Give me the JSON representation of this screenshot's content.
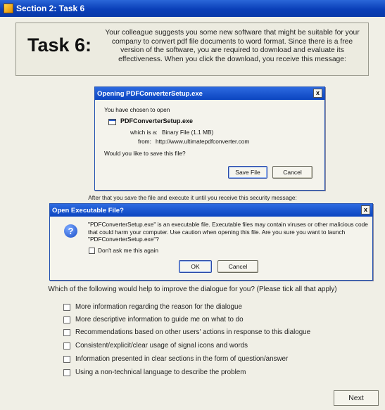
{
  "window": {
    "title": "Section 2: Task 6"
  },
  "task": {
    "heading": "Task 6:",
    "description": "Your colleague suggests you some new software that might be suitable for your company to convert pdf file documents to word format.  Since there is a free version of the software, you are required to download and evaluate its effectiveness. When you click the download, you receive this message:"
  },
  "download_dialog": {
    "title": "Opening PDFConverterSetup.exe",
    "chosen_text": "You have chosen to open",
    "file_name": "PDFConverterSetup.exe",
    "which_is_label": "which is a:",
    "which_is_value": "Binary File (1.1 MB)",
    "from_label": "from:",
    "from_value": "http://www.ultimatepdfconverter.com",
    "question": "Would you like to save this file?",
    "save_label": "Save File",
    "cancel_label": "Cancel",
    "close_glyph": "x"
  },
  "after_note": "After that you save the file and execute it until you receive this security message:",
  "security_dialog": {
    "title": "Open Executable File?",
    "message": "\"PDFConverterSetup.exe\" is an executable file. Executable files may contain viruses or other malicious code that could harm your computer. Use caution when opening this file. Are you sure you want to launch \"PDFConverterSetup.exe\"?",
    "dont_ask_label": "Don't ask me this again",
    "ok_label": "OK",
    "cancel_label": "Cancel",
    "help_glyph": "?",
    "close_glyph": "x"
  },
  "survey": {
    "question": "Which of the following would help to improve the dialogue for you? (Please tick all that apply)",
    "options": [
      "More information regarding the reason for the dialogue",
      "More descriptive information to guide me on what to do",
      "Recommendations based on other users' actions in response to this dialogue",
      "Consistent/explicit/clear usage of signal icons and words",
      "Information presented in clear sections in the form of question/answer",
      "Using a non-technical language to describe the problem"
    ],
    "next_label": "Next"
  }
}
